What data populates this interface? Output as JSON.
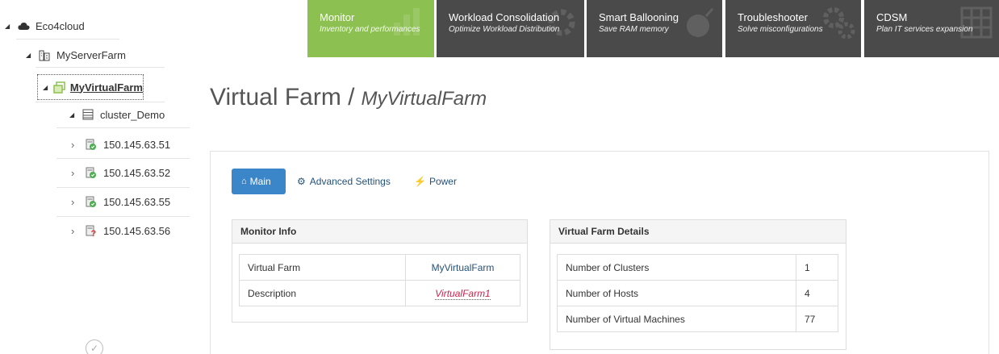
{
  "sidebar": {
    "root": {
      "label": "Eco4cloud"
    },
    "server_farm": {
      "label": "MyServerFarm"
    },
    "virtual_farm": {
      "label": "MyVirtualFarm"
    },
    "cluster": {
      "label": "cluster_Demo"
    },
    "hosts": [
      {
        "label": "150.145.63.51",
        "status": "ok"
      },
      {
        "label": "150.145.63.52",
        "status": "ok"
      },
      {
        "label": "150.145.63.55",
        "status": "ok"
      },
      {
        "label": "150.145.63.56",
        "status": "error"
      }
    ]
  },
  "top_tabs": [
    {
      "title": "Monitor",
      "subtitle": "Inventory and performances",
      "color": "#8cc152",
      "active": true
    },
    {
      "title": "Workload Consolidation",
      "subtitle": "Optimize Workload Distribution",
      "color": "#4a4a4a"
    },
    {
      "title": "Smart Ballooning",
      "subtitle": "Save RAM memory",
      "color": "#4a4a4a"
    },
    {
      "title": "Troubleshooter",
      "subtitle": "Solve misconfigurations",
      "color": "#4a4a4a"
    },
    {
      "title": "CDSM",
      "subtitle": "Plan IT services expansion",
      "color": "#4a4a4a"
    }
  ],
  "page": {
    "title": "Virtual Farm /",
    "subtitle": "MyVirtualFarm"
  },
  "subtabs": {
    "main": "Main",
    "advanced": "Advanced Settings",
    "power": "Power"
  },
  "monitor_info": {
    "heading": "Monitor Info",
    "rows": [
      {
        "label": "Virtual Farm",
        "value": "MyVirtualFarm"
      },
      {
        "label": "Description",
        "value": "VirtualFarm1"
      }
    ]
  },
  "farm_details": {
    "heading": "Virtual Farm Details",
    "rows": [
      {
        "label": "Number of Clusters",
        "value": "1"
      },
      {
        "label": "Number of Hosts",
        "value": "4"
      },
      {
        "label": "Number of Virtual Machines",
        "value": "77"
      }
    ]
  },
  "colors": {
    "accent_blue": "#3a86c8",
    "monitor_green": "#8cc152",
    "tab_dark": "#4a4a4a",
    "host_ok": "#4caf50",
    "host_error": "#e53935"
  }
}
